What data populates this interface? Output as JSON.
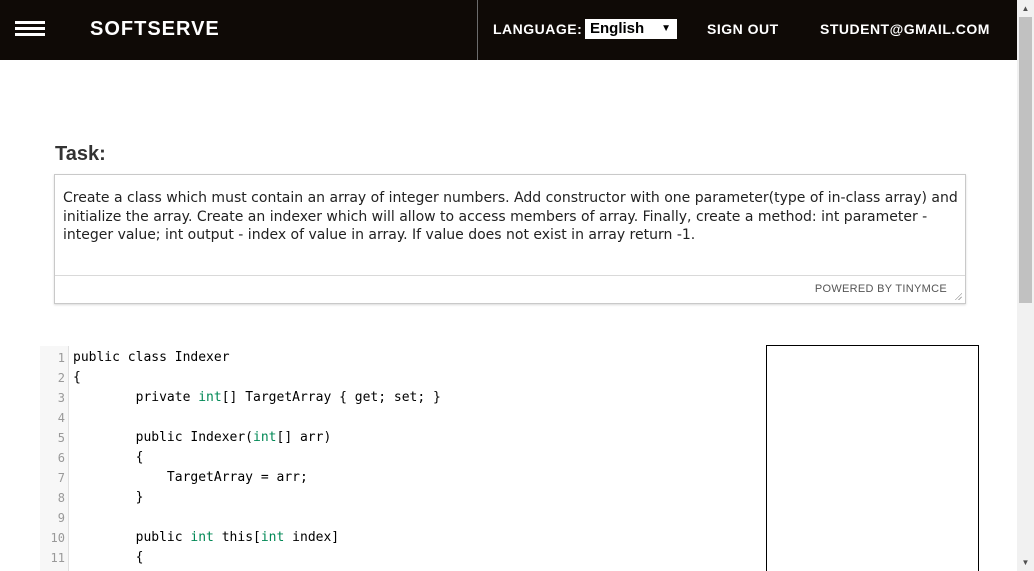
{
  "header": {
    "brand": "SOFTSERVE",
    "language_label": "LANGUAGE:",
    "language_value": "English",
    "sign_out": "SIGN OUT",
    "user_email": "STUDENT@GMAIL.COM"
  },
  "task": {
    "title": "Task:",
    "description": "Create a class which must contain an array of integer numbers. Add constructor with one parameter(type of in-class array) and initialize the array. Create an indexer which will allow to access members of array. Finally, create a method: int parameter - integer value; int output - index of value in array. If value does not exist in array return -1.",
    "powered_by": "POWERED BY TINYMCE"
  },
  "code": {
    "lines": [
      {
        "num": "1",
        "text": "public class Indexer"
      },
      {
        "num": "2",
        "text": "{"
      },
      {
        "num": "3",
        "text": "        private int[] TargetArray { get; set; }"
      },
      {
        "num": "4",
        "text": ""
      },
      {
        "num": "5",
        "text": "        public Indexer(int[] arr)"
      },
      {
        "num": "6",
        "text": "        {"
      },
      {
        "num": "7",
        "text": "            TargetArray = arr;"
      },
      {
        "num": "8",
        "text": "        }"
      },
      {
        "num": "9",
        "text": ""
      },
      {
        "num": "10",
        "text": "        public int this[int index]"
      },
      {
        "num": "11",
        "text": "        {"
      }
    ],
    "keyword_color": "#008855"
  },
  "colors": {
    "header_bg": "#0f0a06",
    "accent_keyword": "#008855"
  },
  "icons": {
    "menu": "hamburger-menu-icon",
    "dropdown": "dropdown-arrow-icon",
    "resize": "resize-grip-icon"
  }
}
